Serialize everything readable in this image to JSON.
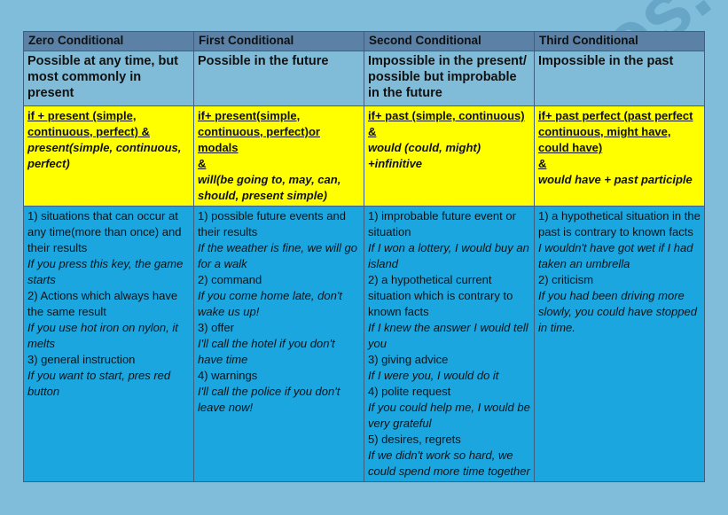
{
  "columns": [
    "Zero Conditional",
    "First Conditional",
    "Second Conditional",
    "Third Conditional"
  ],
  "descriptions": [
    " Possible at any time, but most commonly in present",
    "Possible in the future",
    "Impossible in the present/ possible but improbable in the future",
    "Impossible in the past"
  ],
  "forms": [
    [
      {
        "text": "if + present (simple,",
        "u": true,
        "i": false
      },
      {
        "text": "continuous, perfect) &",
        "u": true,
        "i": false
      },
      {
        "text": "present(simple, continuous,",
        "u": false,
        "i": true
      },
      {
        "text": "perfect)",
        "u": false,
        "i": true
      }
    ],
    [
      {
        "text": "if+ present(simple,",
        "u": true,
        "i": false
      },
      {
        "text": "continuous, perfect)or",
        "u": true,
        "i": false
      },
      {
        "text": "modals",
        "u": true,
        "i": false
      },
      {
        "text": "&",
        "u": true,
        "i": false
      },
      {
        "text": "will(be going to, may, can,",
        "u": false,
        "i": true
      },
      {
        "text": "should, present simple)",
        "u": false,
        "i": true
      }
    ],
    [
      {
        "text": "if+ past (simple, continuous)",
        "u": true,
        "i": false
      },
      {
        "text": "&",
        "u": true,
        "i": false
      },
      {
        "text": "would (could, might)",
        "u": false,
        "i": true
      },
      {
        "text": "+infinitive",
        "u": false,
        "i": true
      }
    ],
    [
      {
        "text": "if+ past perfect (past perfect",
        "u": true,
        "i": false
      },
      {
        "text": "continuous, might have,",
        "u": true,
        "i": false
      },
      {
        "text": "could have)",
        "u": true,
        "i": false
      },
      {
        "text": "&",
        "u": true,
        "i": false
      },
      {
        "text": "would have + past participle",
        "u": false,
        "i": true
      }
    ]
  ],
  "uses": [
    [
      {
        "text": "1) situations that can occur at",
        "i": false
      },
      {
        "text": "any time(more than once) and",
        "i": false
      },
      {
        "text": "their results",
        "i": false
      },
      {
        "text": "If you press this key, the game",
        "i": true
      },
      {
        "text": "starts",
        "i": true
      },
      {
        "text": "2) Actions which always have",
        "i": false
      },
      {
        "text": "the same result",
        "i": false
      },
      {
        "text": "If you use hot iron on nylon, it",
        "i": true
      },
      {
        "text": "melts",
        "i": true
      },
      {
        "text": "3) general instruction",
        "i": false
      },
      {
        "text": "If you want to start, pres red",
        "i": true
      },
      {
        "text": "button",
        "i": true
      }
    ],
    [
      {
        "text": "1) possible future events and",
        "i": false
      },
      {
        "text": "their results",
        "i": false
      },
      {
        "text": "If the weather is fine, we will go",
        "i": true
      },
      {
        "text": "for a walk",
        "i": true
      },
      {
        "text": "2) command",
        "i": false
      },
      {
        "text": "If you come home late, don't",
        "i": true
      },
      {
        "text": "wake us up!",
        "i": true
      },
      {
        "text": "3) offer",
        "i": false
      },
      {
        "text": "I'll call the hotel if you don't",
        "i": true
      },
      {
        "text": "have time",
        "i": true
      },
      {
        "text": "4) warnings",
        "i": false
      },
      {
        "text": "I'll call the police if you don't",
        "i": true
      },
      {
        "text": "leave now!",
        "i": true
      }
    ],
    [
      {
        "text": "1) improbable future event or",
        "i": false
      },
      {
        "text": "situation",
        "i": false
      },
      {
        "text": "If I won a lottery, I would buy an",
        "i": true
      },
      {
        "text": "island",
        "i": true
      },
      {
        "text": "2) a hypothetical current",
        "i": false
      },
      {
        "text": "situation which is contrary to",
        "i": false
      },
      {
        "text": "known facts",
        "i": false
      },
      {
        "text": "If I knew the answer I would tell",
        "i": true
      },
      {
        "text": "you",
        "i": true
      },
      {
        "text": "3) giving advice",
        "i": false
      },
      {
        "text": "If I were you, I would do it",
        "i": true
      },
      {
        "text": "4) polite request",
        "i": false
      },
      {
        "text": "If you could help me, I would be",
        "i": true
      },
      {
        "text": "very grateful",
        "i": true
      },
      {
        "text": "5) desires, regrets",
        "i": false
      },
      {
        "text": "If we didn't work so hard, we",
        "i": true
      },
      {
        "text": "could spend more time together",
        "i": true
      }
    ],
    [
      {
        "text": "1) a hypothetical situation in the",
        "i": false
      },
      {
        "text": "past is contrary to known facts",
        "i": false
      },
      {
        "text": "I wouldn't have got wet if I had",
        "i": true
      },
      {
        "text": "taken an umbrella",
        "i": true
      },
      {
        "text": "2) criticism",
        "i": false
      },
      {
        "text": "If you had been driving more",
        "i": true
      },
      {
        "text": "slowly, you could have stopped",
        "i": true
      },
      {
        "text": "in time.",
        "i": true
      }
    ]
  ],
  "watermark": "eslprintables.com",
  "colors": {
    "background": "#7fbddb",
    "header": "#5b82a6",
    "formula_row": "#ffff00",
    "uses_row": "#1ba6e0"
  }
}
